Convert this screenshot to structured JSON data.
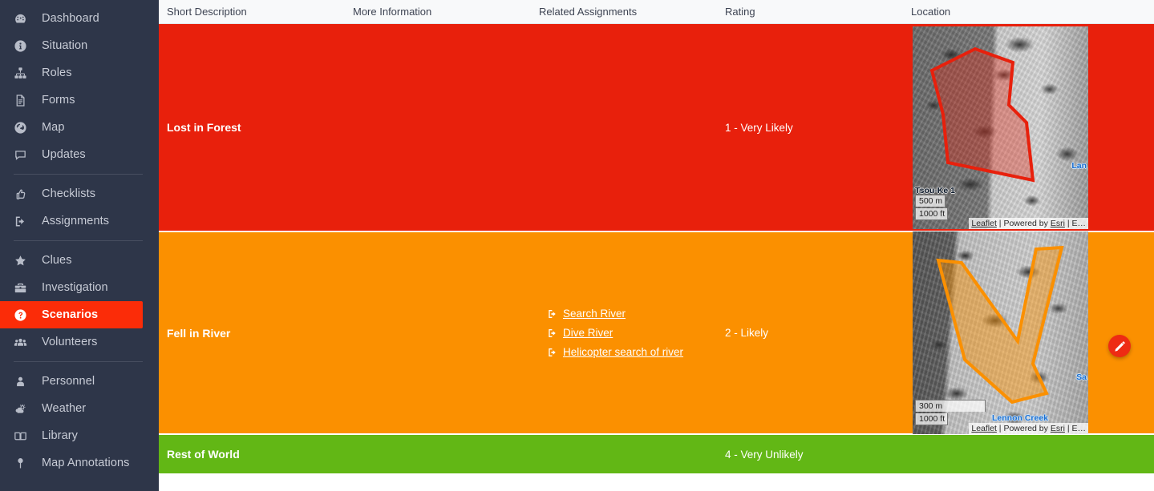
{
  "sidebar": {
    "groups": [
      {
        "items": [
          {
            "label": "Dashboard",
            "icon": "dashboard-icon",
            "key": "dashboard",
            "active": false
          },
          {
            "label": "Situation",
            "icon": "info-icon",
            "key": "situation",
            "active": false
          },
          {
            "label": "Roles",
            "icon": "org-chart-icon",
            "key": "roles",
            "active": false
          },
          {
            "label": "Forms",
            "icon": "document-icon",
            "key": "forms",
            "active": false
          },
          {
            "label": "Map",
            "icon": "globe-icon",
            "key": "map",
            "active": false
          },
          {
            "label": "Updates",
            "icon": "chat-bubble-icon",
            "key": "updates",
            "active": false
          }
        ]
      },
      {
        "items": [
          {
            "label": "Checklists",
            "icon": "thumbs-up-icon",
            "key": "checklists",
            "active": false
          },
          {
            "label": "Assignments",
            "icon": "sign-out-icon",
            "key": "assignments",
            "active": false
          }
        ]
      },
      {
        "items": [
          {
            "label": "Clues",
            "icon": "star-icon",
            "key": "clues",
            "active": false
          },
          {
            "label": "Investigation",
            "icon": "briefcase-icon",
            "key": "investigation",
            "active": false
          },
          {
            "label": "Scenarios",
            "icon": "question-circle-icon",
            "key": "scenarios",
            "active": true
          },
          {
            "label": "Volunteers",
            "icon": "people-icon",
            "key": "volunteers",
            "active": false
          }
        ]
      },
      {
        "items": [
          {
            "label": "Personnel",
            "icon": "person-icon",
            "key": "personnel",
            "active": false
          },
          {
            "label": "Weather",
            "icon": "weather-sun-cloud-icon",
            "key": "weather",
            "active": false
          },
          {
            "label": "Library",
            "icon": "book-icon",
            "key": "library",
            "active": false
          },
          {
            "label": "Map Annotations",
            "icon": "map-pin-icon",
            "key": "map-annotations",
            "active": false
          }
        ]
      }
    ]
  },
  "table": {
    "columns": [
      {
        "label": "Short Description"
      },
      {
        "label": "More Information"
      },
      {
        "label": "Related Assignments"
      },
      {
        "label": "Rating"
      },
      {
        "label": "Location"
      }
    ],
    "rows": [
      {
        "short_description": "Lost in Forest",
        "more_information": "",
        "related_assignments": [],
        "rating": "1 - Very Likely",
        "color": "#e8200c",
        "map": {
          "labels": [
            {
              "text": "Tsou-Ke 1",
              "type": "place"
            },
            {
              "text": "Lan",
              "type": "water"
            }
          ],
          "scale_metric": "500 m",
          "scale_imperial": "1000 ft",
          "attribution_leaflet": "Leaflet",
          "attribution_middle": " | Powered by ",
          "attribution_esri": "Esri",
          "attribution_tail": " | E…",
          "polygon_color": "#e8200c"
        }
      },
      {
        "short_description": "Fell in River",
        "more_information": "",
        "related_assignments": [
          {
            "label": "Search River",
            "icon": "sign-out-icon"
          },
          {
            "label": "Dive River",
            "icon": "sign-out-icon"
          },
          {
            "label": "Helicopter search of river",
            "icon": "sign-out-icon"
          }
        ],
        "rating": "2 - Likely",
        "color": "#fb9000",
        "map": {
          "labels": [
            {
              "text": "Lennon Creek",
              "type": "water"
            },
            {
              "text": "Sa",
              "type": "water"
            }
          ],
          "scale_metric": "300 m",
          "scale_imperial": "1000 ft",
          "attribution_leaflet": "Leaflet",
          "attribution_middle": " | Powered by ",
          "attribution_esri": "Esri",
          "attribution_tail": " | E…",
          "polygon_color": "#fb9000"
        }
      },
      {
        "short_description": "Rest of World",
        "more_information": "",
        "related_assignments": [],
        "rating": "4 - Very Unlikely",
        "color": "#62b715",
        "map": null
      }
    ]
  },
  "fab": {
    "icon": "pencil-icon",
    "title": "Edit",
    "color": "#ee2b13"
  }
}
